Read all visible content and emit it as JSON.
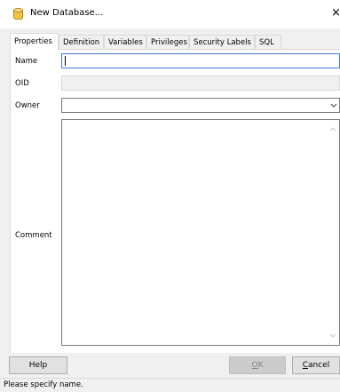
{
  "window": {
    "title": "New Database...",
    "close_glyph": "×",
    "icon": "database-icon"
  },
  "tabs": [
    {
      "label": "Properties",
      "active": true
    },
    {
      "label": "Definition",
      "active": false
    },
    {
      "label": "Variables",
      "active": false
    },
    {
      "label": "Privileges",
      "active": false
    },
    {
      "label": "Security Labels",
      "active": false
    },
    {
      "label": "SQL",
      "active": false
    }
  ],
  "form": {
    "name_label": "Name",
    "name_value": "",
    "oid_label": "OID",
    "oid_value": "",
    "owner_label": "Owner",
    "owner_value": "",
    "comment_label": "Comment",
    "comment_value": ""
  },
  "buttons": {
    "help": "Help",
    "ok_accel": "O",
    "ok_rest": "K",
    "cancel_accel": "C",
    "cancel_rest": "ancel"
  },
  "status": {
    "text": "Please specify name."
  },
  "colors": {
    "focus_border": "#3a7fd0",
    "dialog_bg": "#f0f0f0",
    "db_icon_fill": "#f5c542"
  }
}
